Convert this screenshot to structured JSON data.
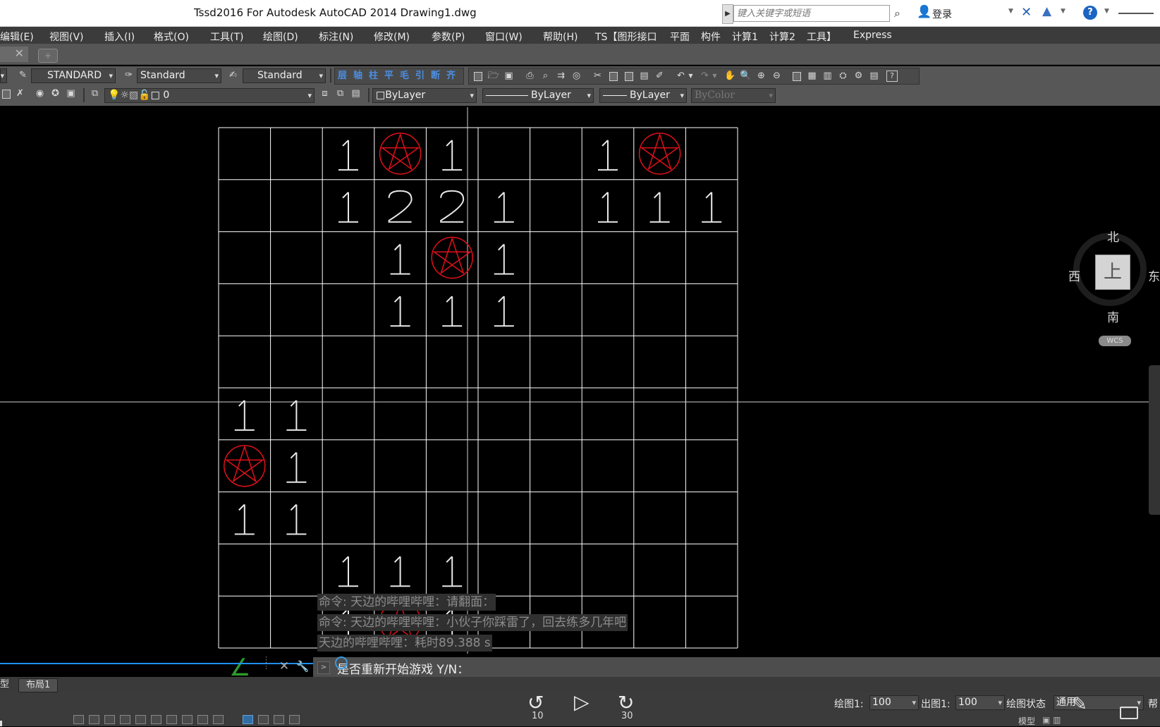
{
  "window": {
    "title": "Tssd2016 For Autodesk AutoCAD 2014    Drawing1.dwg",
    "search_placeholder": "键入关键字或短语",
    "login_label": "登录",
    "help_symbol": "?"
  },
  "menu": {
    "items": [
      "编辑(E)",
      "视图(V)",
      "插入(I)",
      "格式(O)",
      "工具(T)",
      "绘图(D)",
      "标注(N)",
      "修改(M)",
      "参数(P)",
      "窗口(W)",
      "帮助(H)",
      "TS【图形接口",
      "平面",
      "构件",
      "计算1",
      "计算2",
      "工具】",
      "Express"
    ]
  },
  "toolbar1": {
    "text_style": "STANDARD",
    "dim_style": "Standard",
    "table_style": "Standard",
    "ts_tools": [
      "层",
      "轴",
      "柱",
      "平",
      "毛",
      "引",
      "断",
      "齐"
    ]
  },
  "toolbar2": {
    "layer": "0",
    "color": "ByLayer",
    "linetype": "ByLayer",
    "lineweight": "ByLayer",
    "plotstyle": "ByColor"
  },
  "game": {
    "cols": 10,
    "rows": 10,
    "cells": [
      [
        "",
        "",
        "1",
        "*",
        "1",
        "",
        "",
        "1",
        "*",
        ""
      ],
      [
        "",
        "",
        "1",
        "2",
        "2",
        "1",
        "",
        "1",
        "1",
        "1"
      ],
      [
        "",
        "",
        "",
        "1",
        "*",
        "1",
        "",
        "",
        "",
        ""
      ],
      [
        "",
        "",
        "",
        "1",
        "1",
        "1",
        "",
        "",
        "",
        ""
      ],
      [
        "",
        "",
        "",
        "",
        "",
        "",
        "",
        "",
        "",
        ""
      ],
      [
        "1",
        "1",
        "",
        "",
        "",
        "",
        "",
        "",
        "",
        ""
      ],
      [
        "*",
        "1",
        "",
        "",
        "",
        "",
        "",
        "",
        "",
        ""
      ],
      [
        "1",
        "1",
        "",
        "",
        "",
        "",
        "",
        "",
        "",
        ""
      ],
      [
        "",
        "",
        "1",
        "1",
        "1",
        "",
        "",
        "",
        "",
        ""
      ],
      [
        "",
        "",
        "1",
        "*",
        "1",
        "",
        "",
        "",
        "",
        ""
      ]
    ],
    "grid_color": "#ffffff",
    "number_color": "#e8e8e8",
    "mine_color": "#e0101a"
  },
  "viewcube": {
    "north": "北",
    "south": "南",
    "west": "西",
    "east": "东",
    "face": "上",
    "wcs": "WCS"
  },
  "command": {
    "history": [
      "命令: 天边的哔哩哔哩：请翻面：",
      "命令: 天边的哔哩哔哩：小伙子你踩雷了，回去练多几年吧",
      "天边的哔哩哔哩：耗时89.388 s"
    ],
    "prompt": "是否重新开始游戏 Y/N："
  },
  "layout_tabs": {
    "model": "型",
    "layout1": "布局1"
  },
  "status": {
    "draw_scale_label": "绘图1:",
    "draw_scale_value": "100",
    "out_scale_label": "出图1:",
    "out_scale_value": "100",
    "state_label": "绘图状态",
    "state_value": "通用",
    "help_cut": "帮",
    "rewind_seconds": "10",
    "forward_seconds": "30",
    "model_label": "模型"
  }
}
